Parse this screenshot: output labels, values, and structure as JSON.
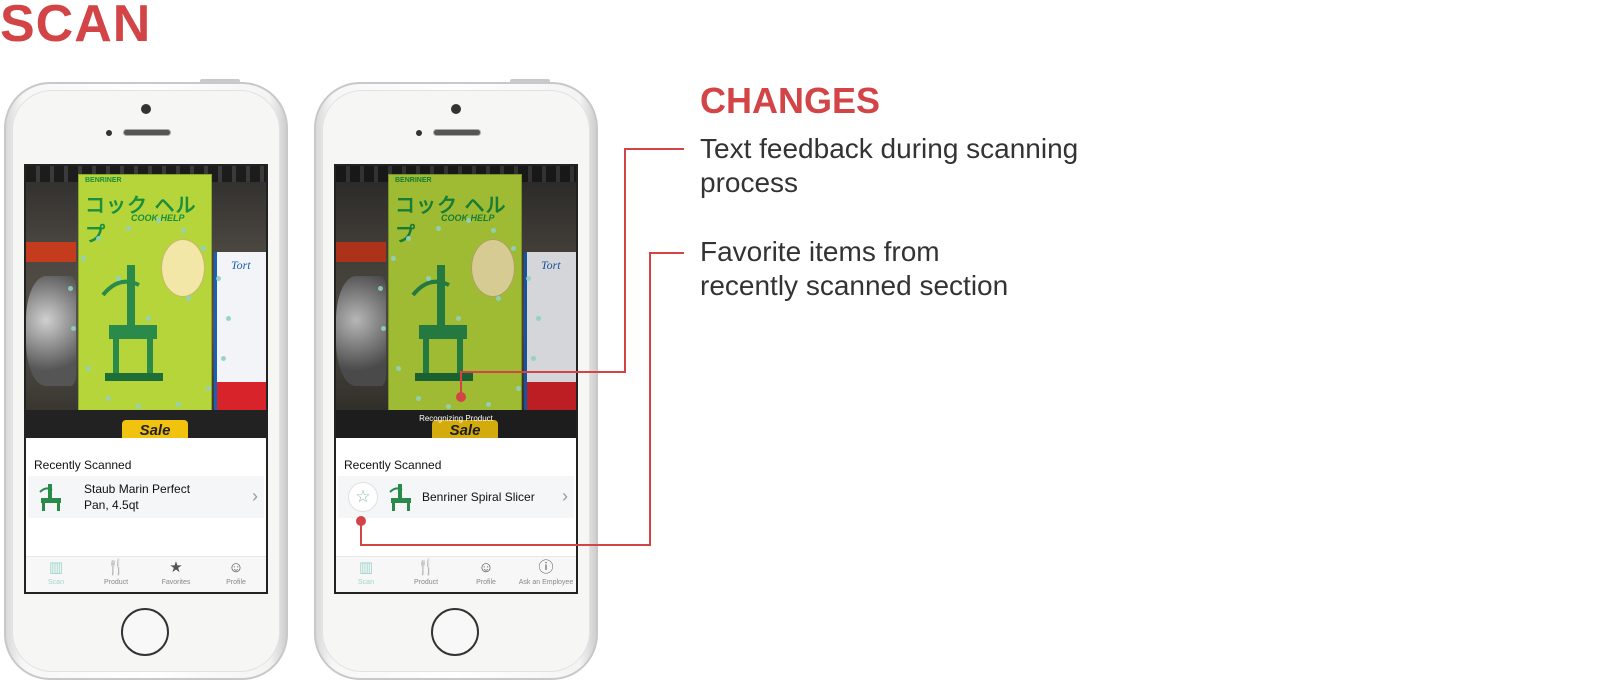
{
  "title": "SCAN",
  "changes": {
    "heading": "CHANGES",
    "items": [
      {
        "line1": "Text feedback during scanning",
        "line2": "process"
      },
      {
        "line1": "Favorite items from",
        "line2": "recently scanned section"
      }
    ]
  },
  "phone1": {
    "box_jp": "コック ヘルプ",
    "box_brand": "BENRINER",
    "box_sub": "COOK HELP",
    "side_label": "Tort",
    "sale_label": "Sale",
    "recent_heading": "Recently Scanned",
    "recent_item": {
      "line1": "Staub Marin Perfect",
      "line2": "Pan, 4.5qt"
    },
    "tabs": [
      {
        "label": "Scan",
        "icon": "barcode-icon",
        "active": true
      },
      {
        "label": "Product",
        "icon": "utensils-icon",
        "active": false
      },
      {
        "label": "Favorites",
        "icon": "star-icon",
        "active": false
      },
      {
        "label": "Profile",
        "icon": "profile-icon",
        "active": false
      }
    ]
  },
  "phone2": {
    "box_jp": "コック ヘルプ",
    "box_brand": "BENRINER",
    "box_sub": "COOK HELP",
    "side_label": "Tort",
    "sale_label": "Sale",
    "status_text": "Recognizing Product",
    "recent_heading": "Recently Scanned",
    "recent_item": {
      "line1": "Benriner Spiral Slicer"
    },
    "tabs": [
      {
        "label": "Scan",
        "icon": "barcode-icon",
        "active": true
      },
      {
        "label": "Product",
        "icon": "utensils-icon",
        "active": false
      },
      {
        "label": "Profile",
        "icon": "profile-icon",
        "active": false
      },
      {
        "label": "Ask an Employee",
        "icon": "question-icon",
        "active": false
      }
    ]
  },
  "colors": {
    "accent": "#d24446",
    "teal": "#9fd4cb",
    "product_green": "#1b8f3c"
  }
}
